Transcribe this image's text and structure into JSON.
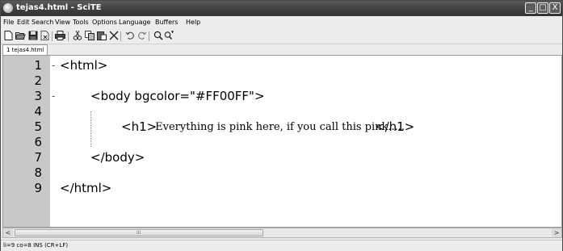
{
  "window": {
    "title": "tejas4.html - SciTE"
  },
  "controls": {
    "minimize": "_",
    "maximize": "□",
    "close": "X"
  },
  "menu": [
    "File",
    "Edit",
    "Search",
    "View",
    "Tools",
    "Options",
    "Language",
    "Buffers",
    "Help"
  ],
  "toolbar": [
    "new-file-icon",
    "open-file-icon",
    "save-icon",
    "close-file-icon",
    "print-icon",
    "cut-icon",
    "copy-icon",
    "paste-icon",
    "delete-icon",
    "undo-icon",
    "redo-icon",
    "find-icon",
    "replace-icon"
  ],
  "tabs": [
    {
      "label": "1 tejas4.html",
      "active": true
    }
  ],
  "editor": {
    "lines": [
      {
        "num": "1",
        "fold": "-",
        "text": "<html>"
      },
      {
        "num": "2",
        "fold": "",
        "text": ""
      },
      {
        "num": "3",
        "fold": "-",
        "text": "<body bgcolor=\"#FF00FF\">"
      },
      {
        "num": "4",
        "fold": "",
        "text": ""
      },
      {
        "num": "5",
        "fold": "",
        "tag_open": "<h1>",
        "content": " Everything is pink here, if you call this pink..... ",
        "tag_close": "</h1>"
      },
      {
        "num": "6",
        "fold": "",
        "text": ""
      },
      {
        "num": "7",
        "fold": "",
        "text": "</body>"
      },
      {
        "num": "8",
        "fold": "",
        "text": ""
      },
      {
        "num": "9",
        "fold": "",
        "text": "</html>"
      }
    ]
  },
  "scrollbar": {
    "left_arrow": "<",
    "right_arrow": ">",
    "grip": "III"
  },
  "status": "li=9 co=8 INS (CR+LF)"
}
